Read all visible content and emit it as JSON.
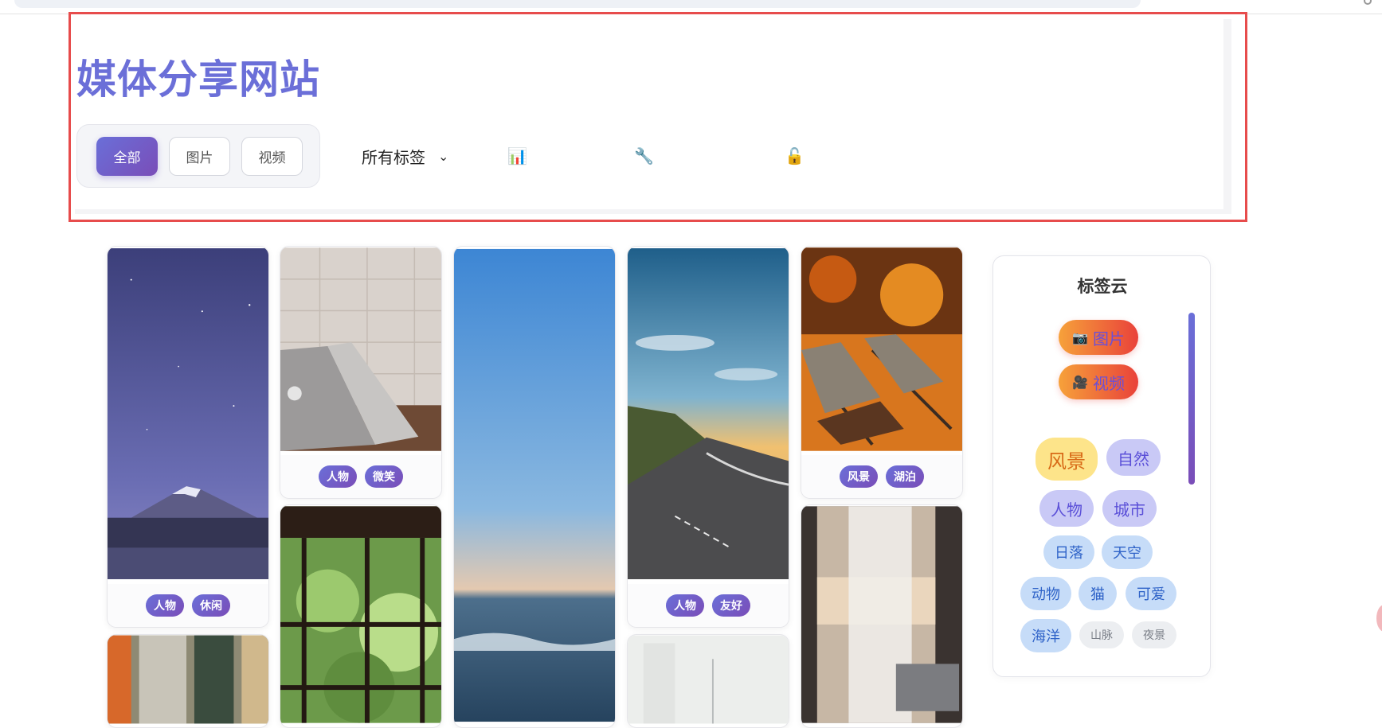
{
  "site": {
    "title": "媒体分享网站"
  },
  "filters": {
    "types": [
      {
        "label": "全部",
        "active": true
      },
      {
        "label": "图片",
        "active": false
      },
      {
        "label": "视频",
        "active": false
      }
    ],
    "tag_select": {
      "selected": "所有标签"
    },
    "tool_icons": [
      "bar-chart-icon",
      "wrench-icon",
      "lock-icon"
    ]
  },
  "gallery": {
    "cards": [
      {
        "tags": [
          "人物",
          "休闲"
        ]
      },
      {
        "tags": [
          "人物",
          "微笑"
        ]
      },
      {
        "tags": []
      },
      {
        "tags": [
          "人物",
          "友好"
        ]
      },
      {
        "tags": [
          "风景",
          "湖泊"
        ]
      }
    ]
  },
  "tag_cloud": {
    "title": "标签云",
    "type_tags": [
      {
        "icon": "camera-icon",
        "label": "图片"
      },
      {
        "icon": "video-camera-icon",
        "label": "视频"
      }
    ],
    "tags": [
      "风景",
      "自然",
      "人物",
      "城市",
      "日落",
      "天空",
      "动物",
      "猫",
      "可爱",
      "海洋",
      "山脉",
      "夜景"
    ]
  },
  "colors": {
    "accent": "#6a6fd8",
    "accent_dark": "#7a4db8",
    "title": "#6b6fd8",
    "highlight_border": "#e74c4c"
  }
}
